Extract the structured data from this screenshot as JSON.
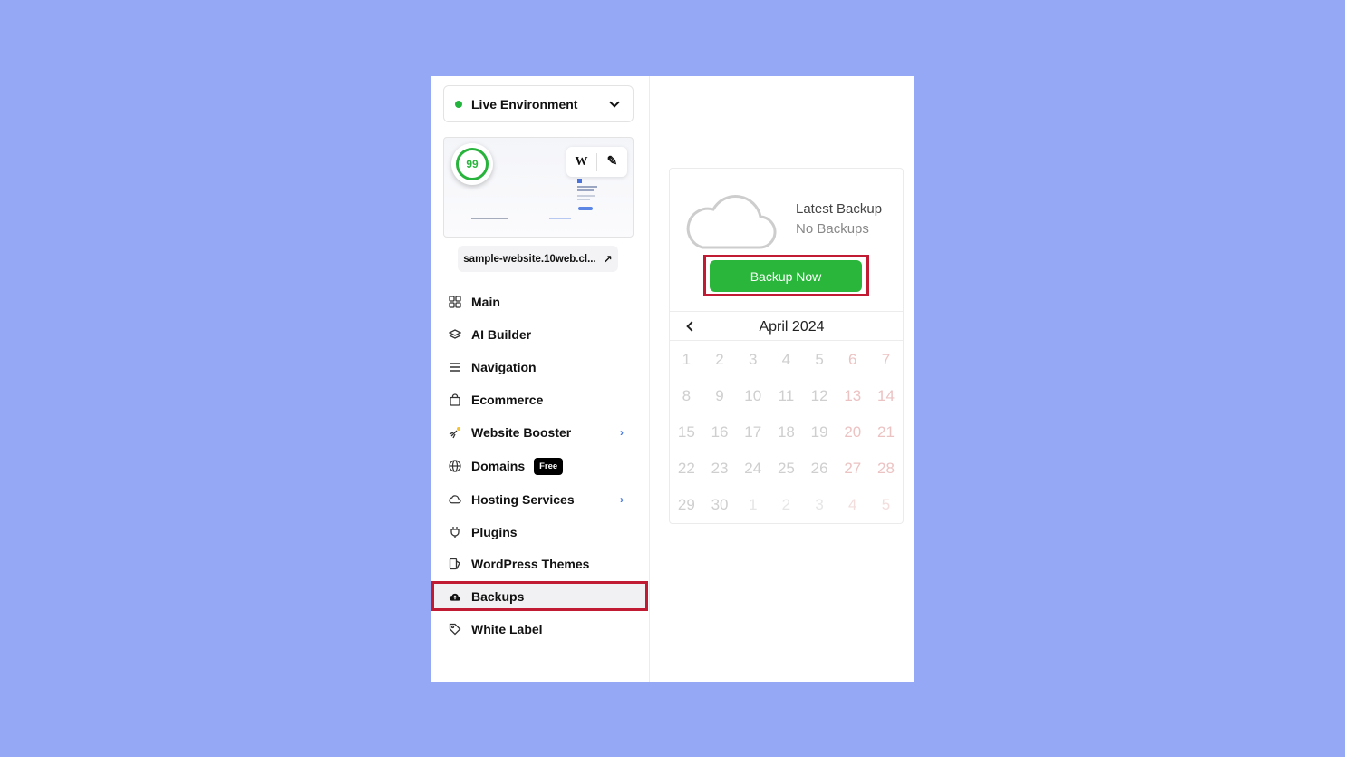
{
  "environment": {
    "label": "Live Environment",
    "status_color": "#22b43c"
  },
  "preview": {
    "score": "99",
    "wp_tool": "W",
    "edit_tool": "✎"
  },
  "site": {
    "url": "sample-website.10web.cl...",
    "open_icon": "↗"
  },
  "nav": {
    "items": [
      {
        "label": "Main",
        "icon": "grid-icon"
      },
      {
        "label": "AI Builder",
        "icon": "layers-icon"
      },
      {
        "label": "Navigation",
        "icon": "menu-icon"
      },
      {
        "label": "Ecommerce",
        "icon": "bag-icon"
      },
      {
        "label": "Website Booster",
        "icon": "rocket-icon",
        "arrow": "›"
      },
      {
        "label": "Domains",
        "icon": "globe-icon",
        "badge": "Free"
      },
      {
        "label": "Hosting Services",
        "icon": "cloud-icon",
        "arrow": "›"
      },
      {
        "label": "Plugins",
        "icon": "plug-icon"
      },
      {
        "label": "WordPress Themes",
        "icon": "theme-icon"
      },
      {
        "label": "Backups",
        "icon": "cloud-upload-icon",
        "active": true
      },
      {
        "label": "White Label",
        "icon": "tag-icon"
      }
    ]
  },
  "backup": {
    "title": "Latest Backup",
    "status": "No Backups",
    "button_label": "Backup Now",
    "button_color": "#29b63a"
  },
  "calendar": {
    "month": "April 2024",
    "weeks": [
      [
        "1",
        "2",
        "3",
        "4",
        "5",
        "6",
        "7"
      ],
      [
        "8",
        "9",
        "10",
        "11",
        "12",
        "13",
        "14"
      ],
      [
        "15",
        "16",
        "17",
        "18",
        "19",
        "20",
        "21"
      ],
      [
        "22",
        "23",
        "24",
        "25",
        "26",
        "27",
        "28"
      ],
      [
        "29",
        "30",
        "1",
        "2",
        "3",
        "4",
        "5"
      ]
    ]
  },
  "highlight_color": "#c11a33"
}
